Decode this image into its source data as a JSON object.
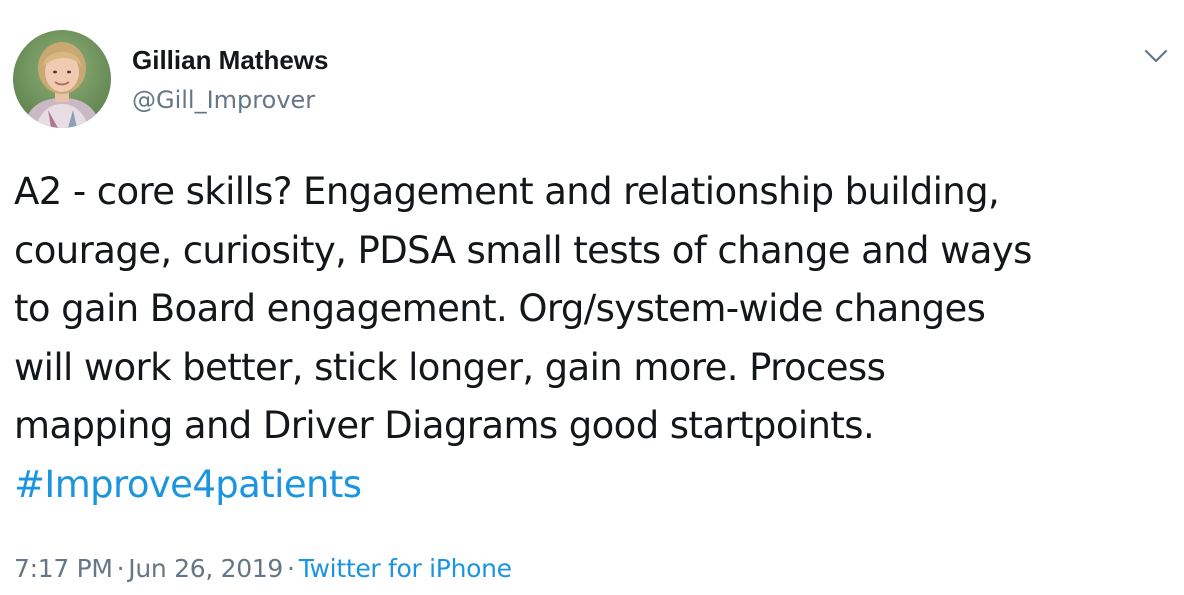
{
  "author": {
    "display_name": "Gillian Mathews",
    "handle": "@Gill_Improver"
  },
  "tweet": {
    "lines": [
      "A2 - core skills? Engagement and relationship building,",
      "courage, curiosity, PDSA small tests of change and ways",
      "to gain Board engagement. Org/system-wide changes",
      "will work better, stick longer, gain more. Process",
      "mapping and Driver Diagrams good startpoints."
    ],
    "hashtag": "#Improve4patients"
  },
  "meta": {
    "time": "7:17 PM",
    "separator": "·",
    "date": "Jun 26, 2019",
    "source": "Twitter for iPhone"
  },
  "icons": {
    "menu": "chevron-down-icon",
    "avatar": "profile-photo"
  },
  "colors": {
    "text": "#14171a",
    "secondary": "#657786",
    "link": "#1b95e0"
  }
}
